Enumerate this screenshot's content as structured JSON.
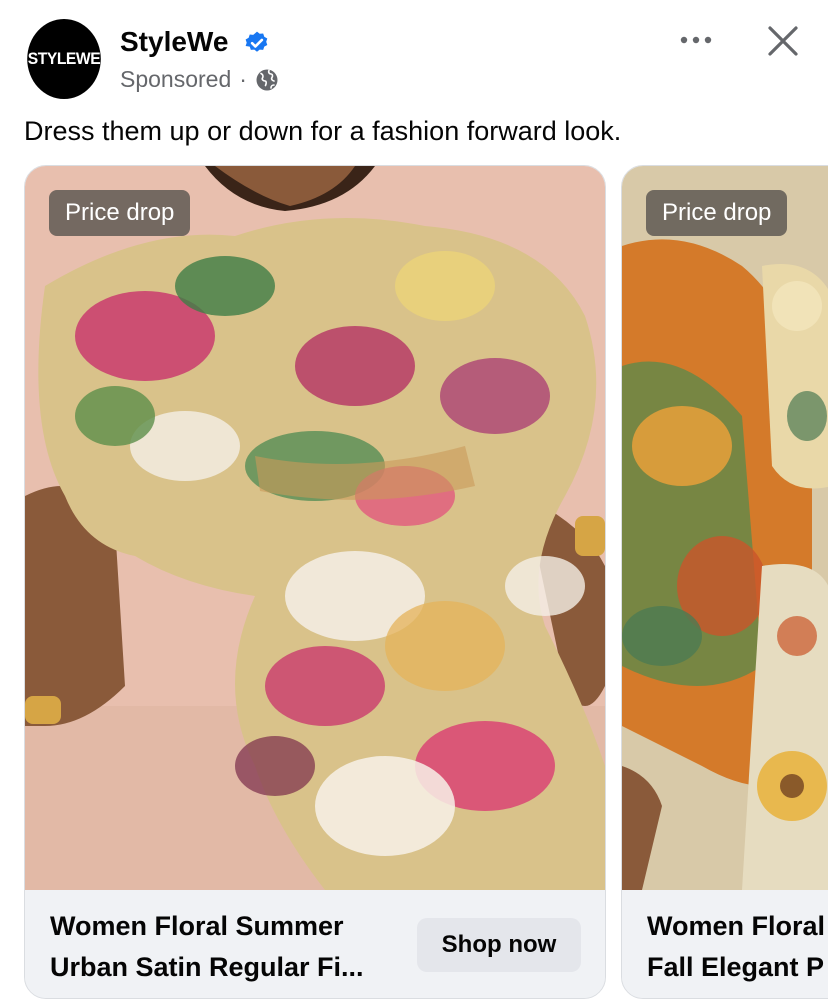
{
  "post": {
    "avatar_text": "STYLEWE",
    "page_name": "StyleWe",
    "sponsored_label": "Sponsored",
    "separator": "·",
    "caption": "Dress them up or down for a fashion forward look."
  },
  "icons": {
    "verified": "verified-badge-icon",
    "privacy": "globe-icon",
    "more": "more-horizontal-icon",
    "close": "close-icon"
  },
  "colors": {
    "verified_blue": "#1877f2",
    "secondary_text": "#65676b",
    "footer_bg": "#f0f2f5",
    "button_bg": "#e4e6eb"
  },
  "carousel": {
    "cards": [
      {
        "badge": "Price drop",
        "title_line1": "Women Floral Summer",
        "title_line2": "Urban Satin Regular Fi...",
        "button_label": "Shop now"
      },
      {
        "badge": "Price drop",
        "title_line1": "Women Floral",
        "title_line2": "Fall Elegant P"
      }
    ]
  }
}
